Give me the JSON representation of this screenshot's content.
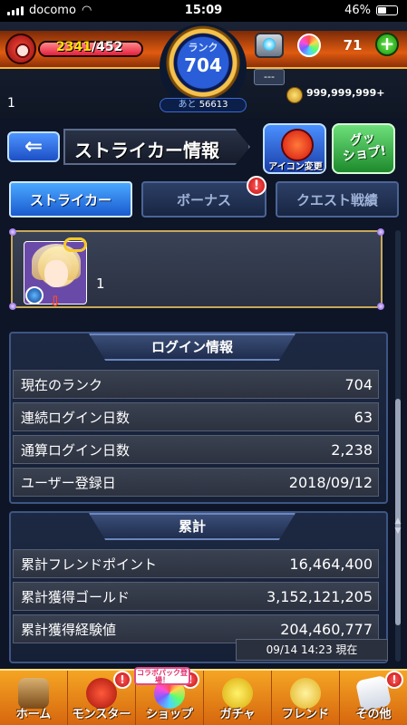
{
  "status_bar": {
    "carrier": "docomo",
    "time": "15:09",
    "battery": "46%",
    "battery_level": 0.46
  },
  "header": {
    "stamina_current": "2341",
    "stamina_max": "/452",
    "rank_label": "ランク",
    "rank_value": "704",
    "exp_prefix": "あと",
    "exp_remaining": "56613",
    "gacha_box_label": "---",
    "orb_count": "71",
    "add_label": "+",
    "player_number": "1",
    "coins": "999,999,999+"
  },
  "title_bar": {
    "back_label": "⇐",
    "title": "ストライカー情報",
    "icon_change_label": "アイコン変更",
    "goods_shop_label": "グッ\nショプ!"
  },
  "tabs": [
    {
      "label": "ストライカー",
      "active": true
    },
    {
      "label": "ボーナス",
      "active": false,
      "badge": "!"
    },
    {
      "label": "クエスト戦績",
      "active": false
    }
  ],
  "profile": {
    "name": "1"
  },
  "login_panel": {
    "title": "ログイン情報",
    "rows": [
      {
        "label": "現在のランク",
        "value": "704"
      },
      {
        "label": "連続ログイン日数",
        "value": "63"
      },
      {
        "label": "通算ログイン日数",
        "value": "2,238"
      },
      {
        "label": "ユーザー登録日",
        "value": "2018/09/12"
      }
    ]
  },
  "total_panel": {
    "title": "累計",
    "rows": [
      {
        "label": "累計フレンドポイント",
        "value": "16,464,400"
      },
      {
        "label": "累計獲得ゴールド",
        "value": "3,152,121,205"
      },
      {
        "label": "累計獲得経験値",
        "value": "204,460,777"
      }
    ]
  },
  "timestamp": "09/14 14:23 現在",
  "bottom_nav": {
    "collab_tag": "コラボパック登場！",
    "items": [
      {
        "label": "ホーム"
      },
      {
        "label": "モンスター",
        "badge": "!"
      },
      {
        "label": "ショップ",
        "badge": "!"
      },
      {
        "label": "ガチャ"
      },
      {
        "label": "フレンド"
      },
      {
        "label": "その他",
        "badge": "!"
      }
    ]
  },
  "colors": {
    "accent_orange": "#e05b10",
    "tab_active_blue": "#1a5bd0",
    "badge_red": "#c20f0f",
    "nav_orange": "#f5a524"
  }
}
